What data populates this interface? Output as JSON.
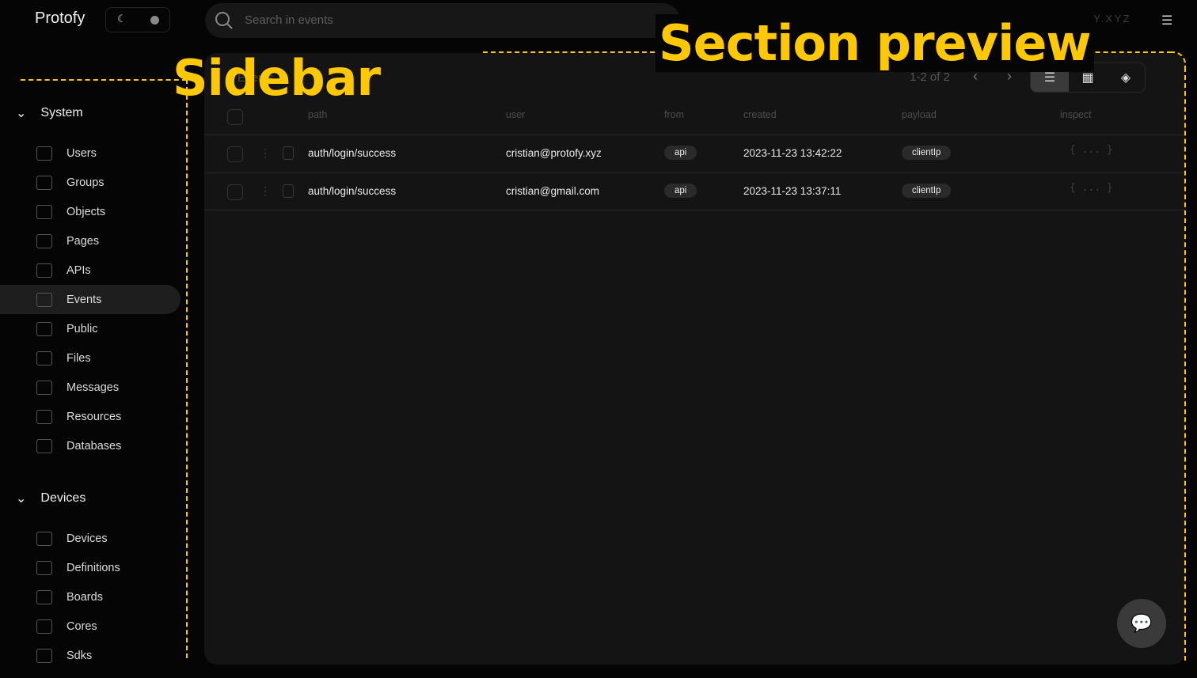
{
  "header": {
    "app_name": "Protofy",
    "search_placeholder": "Search in events",
    "user_email": "CRISTIAN@PROTOFY.XYZ"
  },
  "sidebar": {
    "sections": [
      {
        "label": "System",
        "items": [
          {
            "label": "Users",
            "icon": "users-icon"
          },
          {
            "label": "Groups",
            "icon": "tag-icon"
          },
          {
            "label": "Objects",
            "icon": "box-icon"
          },
          {
            "label": "Pages",
            "icon": "layout-icon"
          },
          {
            "label": "APIs",
            "icon": "api-icon"
          },
          {
            "label": "Events",
            "icon": "clipboard-icon",
            "active": true
          },
          {
            "label": "Public",
            "icon": "door-icon"
          },
          {
            "label": "Files",
            "icon": "folder-icon"
          },
          {
            "label": "Messages",
            "icon": "inbox-icon"
          },
          {
            "label": "Resources",
            "icon": "library-icon"
          },
          {
            "label": "Databases",
            "icon": "database-icon"
          }
        ]
      },
      {
        "label": "Devices",
        "items": [
          {
            "label": "Devices",
            "icon": "device-icon"
          },
          {
            "label": "Definitions",
            "icon": "book-icon"
          },
          {
            "label": "Boards",
            "icon": "board-icon"
          },
          {
            "label": "Cores",
            "icon": "cpu-icon"
          },
          {
            "label": "Sdks",
            "icon": "gear-icon"
          }
        ]
      }
    ]
  },
  "main": {
    "title": "Events",
    "pagination": "1-2 of 2",
    "columns": [
      "path",
      "user",
      "from",
      "created",
      "payload",
      "inspect"
    ],
    "rows": [
      {
        "path": "auth/login/success",
        "user": "cristian@protofy.xyz",
        "from": "api",
        "created": "2023-11-23 13:42:22",
        "payload": "clientIp",
        "inspect": "{ ... }"
      },
      {
        "path": "auth/login/success",
        "user": "cristian@gmail.com",
        "from": "api",
        "created": "2023-11-23 13:37:11",
        "payload": "clientIp",
        "inspect": "{ ... }"
      }
    ]
  },
  "annotations": {
    "sidebar": "Sidebar",
    "section": "Section preview"
  },
  "colors": {
    "accent": "#ffc800",
    "panel": "#141414",
    "background": "#050505"
  }
}
